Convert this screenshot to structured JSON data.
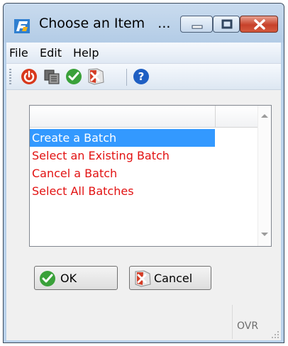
{
  "window": {
    "title": "Choose an Item",
    "title_overflow": "..."
  },
  "colors": {
    "title_bg": "#b9d1ea",
    "selection": "#3399ff",
    "item_text": "#e21212",
    "close": "#c7412a"
  },
  "menu": {
    "items": [
      "File",
      "Edit",
      "Help"
    ]
  },
  "toolbar": {
    "icons": [
      "power-icon",
      "copy-icon",
      "check-icon",
      "cancel-icon",
      "help-icon"
    ]
  },
  "list": {
    "items": [
      "Create a Batch",
      "Select an Existing Batch",
      "Cancel a Batch",
      "Select All Batches"
    ],
    "selected_index": 0
  },
  "buttons": {
    "ok": "OK",
    "cancel": "Cancel"
  },
  "status": {
    "mode": "OVR"
  }
}
